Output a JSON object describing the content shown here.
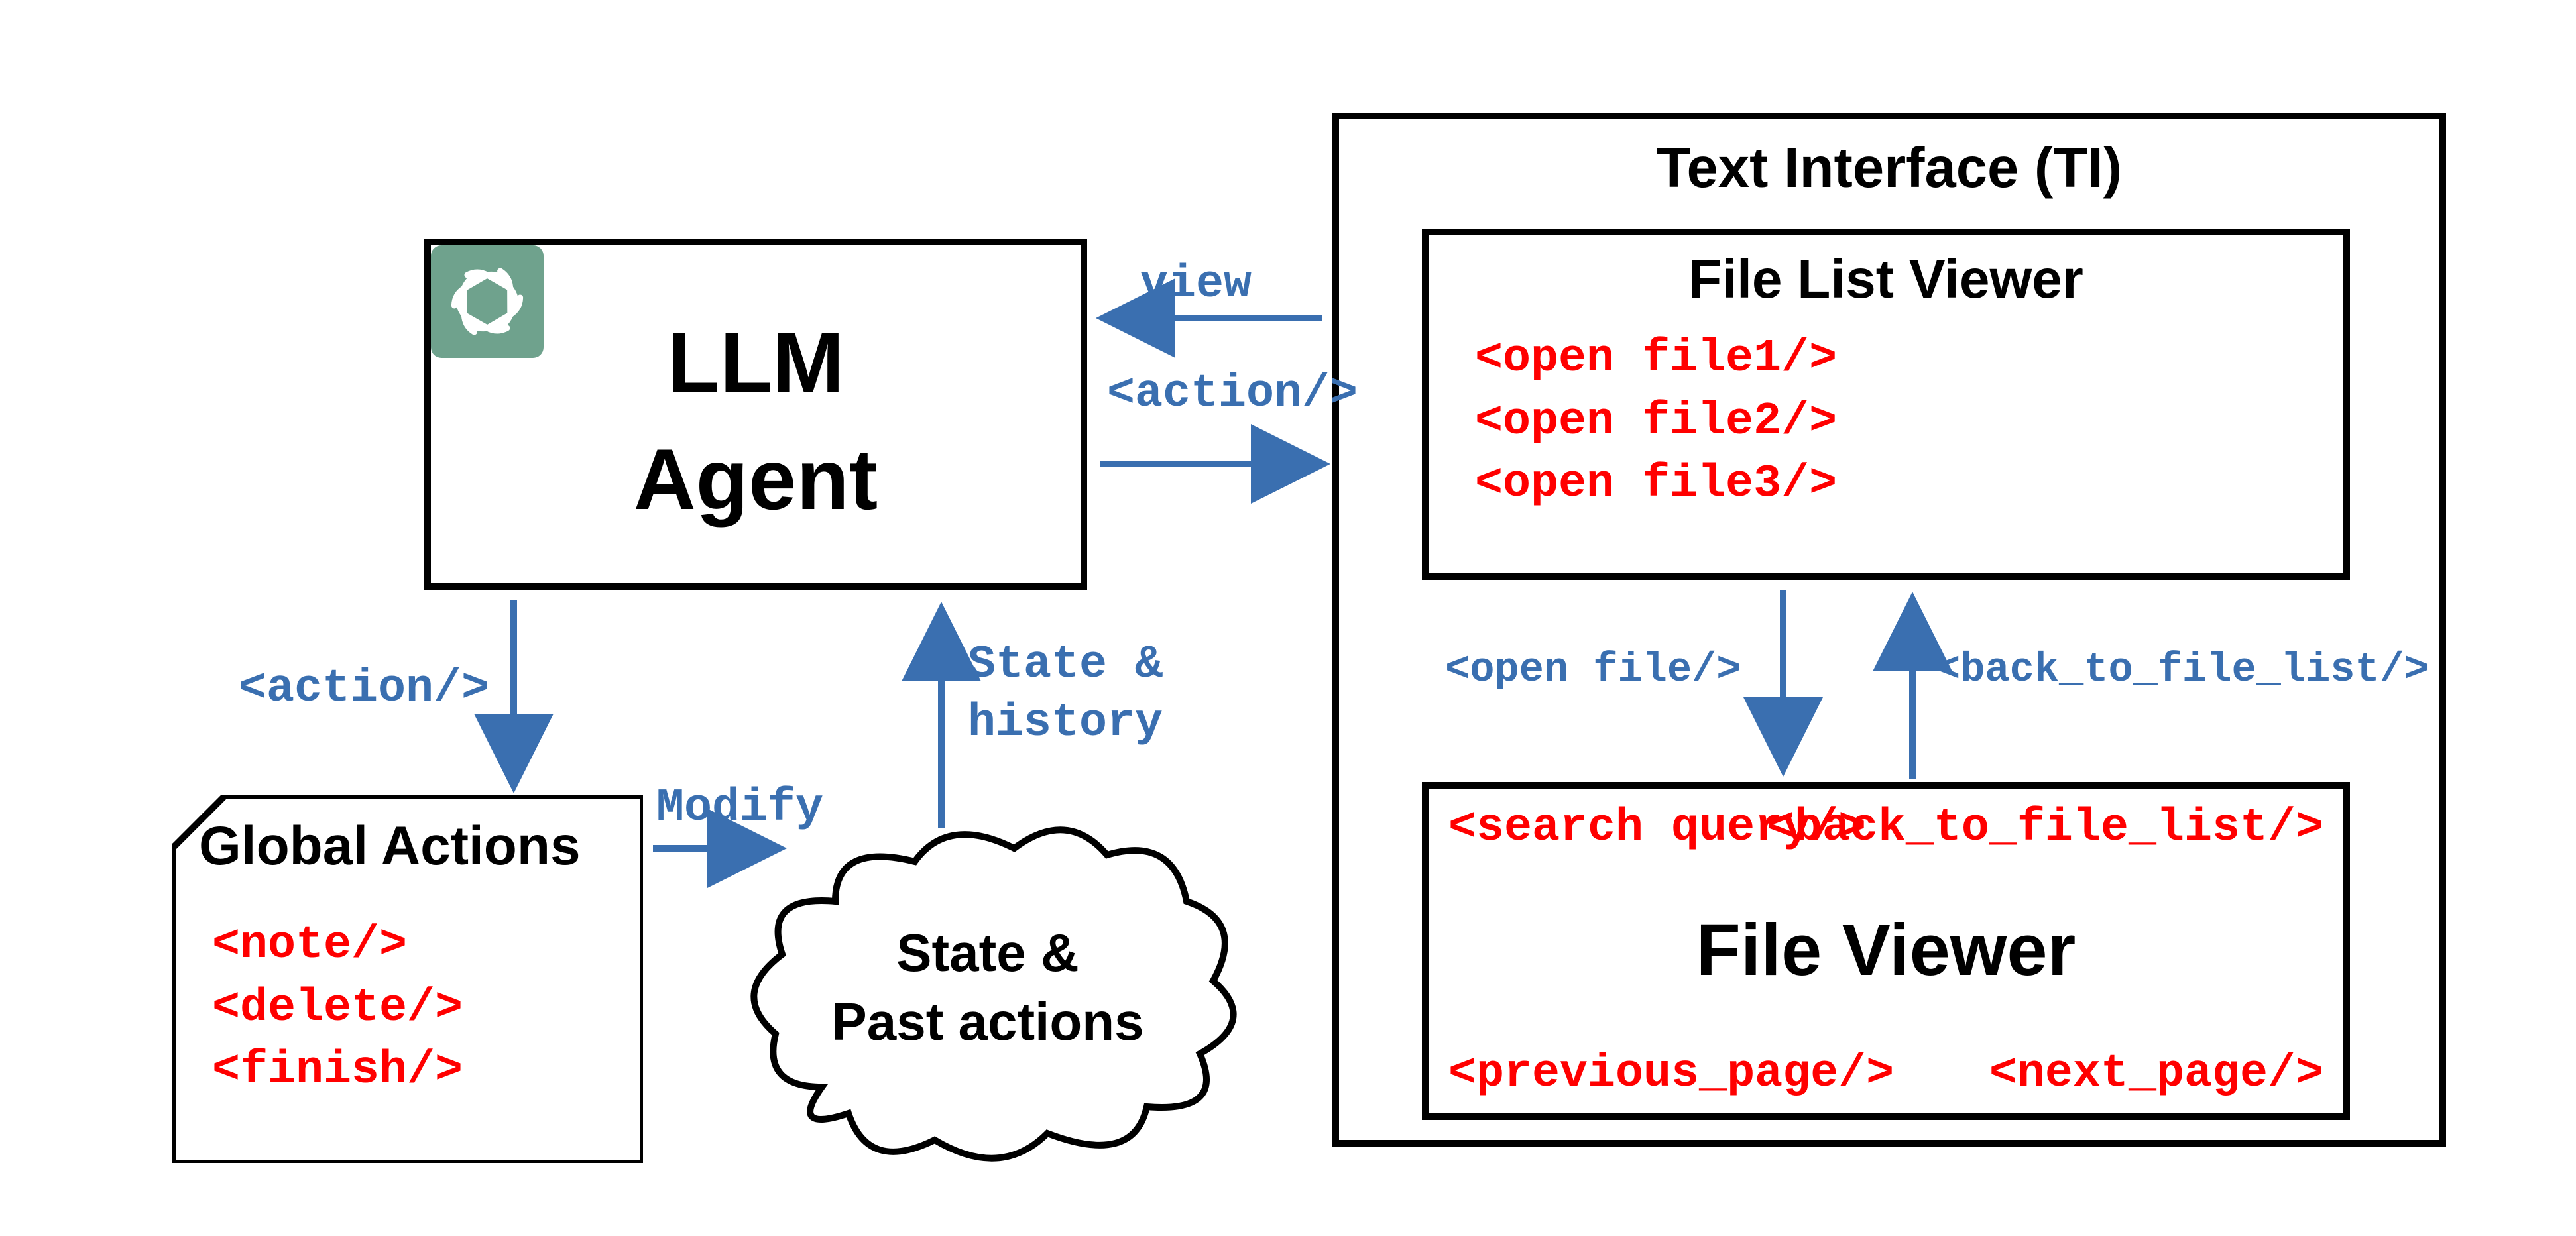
{
  "llm_agent": {
    "title_line1": "LLM",
    "title_line2": "Agent"
  },
  "global_actions": {
    "title": "Global Actions",
    "items": [
      "<note/>",
      "<delete/>",
      "<finish/>"
    ]
  },
  "state_cloud": {
    "line1": "State &",
    "line2": "Past actions"
  },
  "edges": {
    "agent_to_global": "<action/>",
    "global_to_state": "Modify",
    "state_to_agent_line1": "State &",
    "state_to_agent_line2": "history",
    "ti_to_agent": "view",
    "agent_to_ti": "<action/>",
    "flv_to_fv": "<open file/>",
    "fv_to_flv": "<back_to_file_list/>"
  },
  "text_interface": {
    "title": "Text Interface (TI)",
    "file_list_viewer": {
      "title": "File List Viewer",
      "items": [
        "<open file1/>",
        "<open file2/>",
        "<open file3/>"
      ]
    },
    "file_viewer": {
      "title": "File Viewer",
      "top_left": "<search query/>",
      "top_right": "<back_to_file_list/>",
      "bottom_left": "<previous_page/>",
      "bottom_right": "<next_page/>"
    }
  },
  "colors": {
    "red": "#ff0000",
    "blue": "#3a6fb0",
    "teal": "#6fa28d"
  }
}
